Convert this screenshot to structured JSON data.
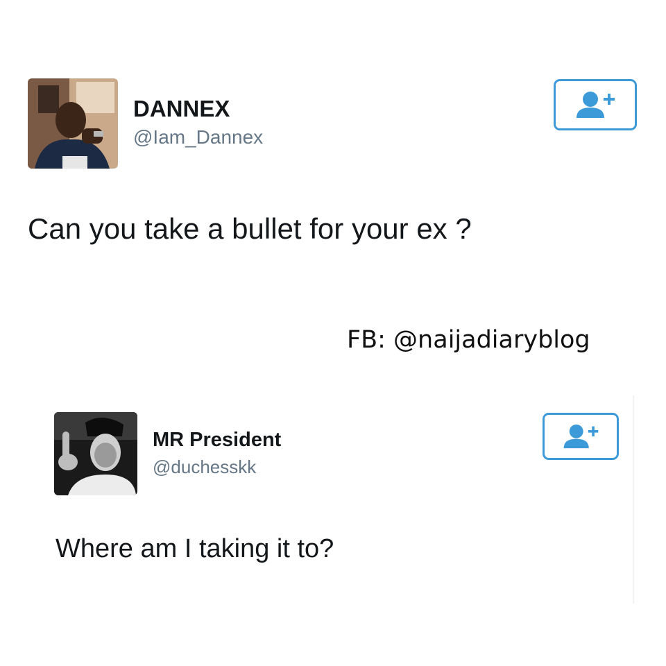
{
  "tweets": [
    {
      "display_name": "DANNEX",
      "handle": "@Iam_Dannex",
      "text": "Can you take a bullet for your ex ?",
      "follow_icon": "follow-user-icon"
    },
    {
      "display_name": "MR President",
      "handle": "@duchesskk",
      "text": "Where am I taking it to?",
      "follow_icon": "follow-user-icon"
    }
  ],
  "watermark": "FB: @naijadiaryblog",
  "colors": {
    "accent": "#3d9ad9",
    "text": "#14171a",
    "handle": "#657786",
    "background": "#ffffff"
  }
}
